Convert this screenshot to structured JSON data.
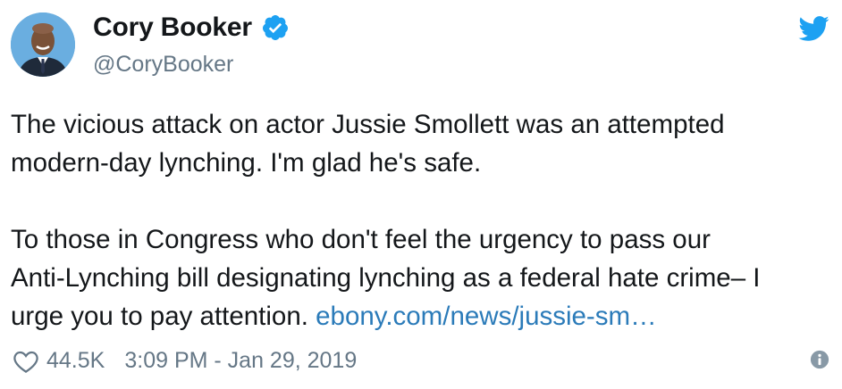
{
  "author": {
    "name": "Cory Booker",
    "handle": "@CoryBooker",
    "verified": true,
    "avatar_icon": "avatar"
  },
  "tweet": {
    "paragraphs": [
      [
        "The vicious attack on actor Jussie Smollett was an attempted",
        "modern-day lynching. I'm glad he's safe."
      ],
      [
        "To those in Congress who don't feel the urgency to pass our",
        "Anti-Lynching bill designating lynching as a federal hate crime– I",
        "urge you to pay attention."
      ]
    ],
    "link_text": "ebony.com/news/jussie-sm…"
  },
  "footer": {
    "likes": "44.5K",
    "timestamp": "3:09 PM - Jan 29, 2019"
  },
  "icons": {
    "brand": "twitter-bird-icon",
    "verified": "verified-badge-icon",
    "like": "heart-icon",
    "info": "info-icon"
  },
  "colors": {
    "text": "#14171a",
    "secondary": "#657786",
    "link": "#2b7bb9",
    "twitter_blue": "#1da1f2"
  }
}
